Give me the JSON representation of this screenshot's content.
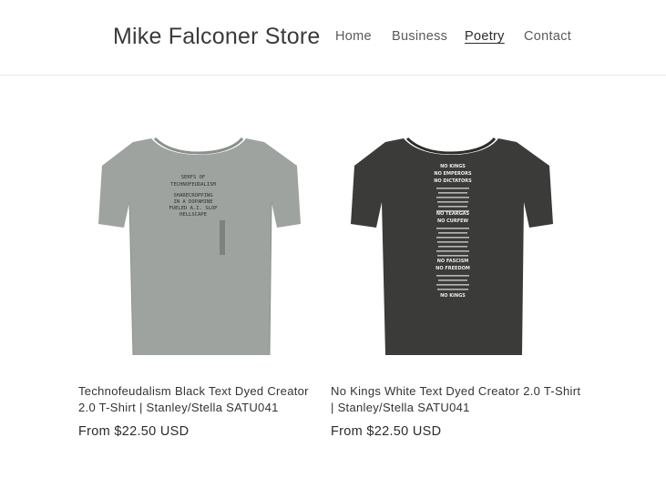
{
  "header": {
    "store_title": "Mike Falconer Store",
    "nav": [
      {
        "label": "Home",
        "active": false
      },
      {
        "label": "Business",
        "active": false
      },
      {
        "label": "Poetry",
        "active": true
      },
      {
        "label": "Contact",
        "active": false
      }
    ]
  },
  "products": [
    {
      "title": "Technofeudalism Black Text Dyed Creator 2.0 T-Shirt | Stanley/Stella SATU041",
      "price": "From $22.50 USD",
      "shirt_color": "#9ea39f",
      "print_text": [
        "SERFS OF",
        "TECHNOFEUDALISM",
        "",
        "SHARECROPPING",
        "IN A DOPAMINE",
        "FUELED A.I. SLOP",
        "HELLSCAPE"
      ]
    },
    {
      "title": "No Kings White Text Dyed Creator 2.0 T-Shirt | Stanley/Stella SATU041",
      "price": "From $22.50 USD",
      "shirt_color": "#3b3b39",
      "print_text": [
        "NO KINGS",
        "NO EMPERORS",
        "NO DICTATORS",
        "NO TEARGAS",
        "NO CURFEW",
        "NO FASCISM",
        "NO FREEDOM",
        "NO KINGS"
      ]
    }
  ]
}
